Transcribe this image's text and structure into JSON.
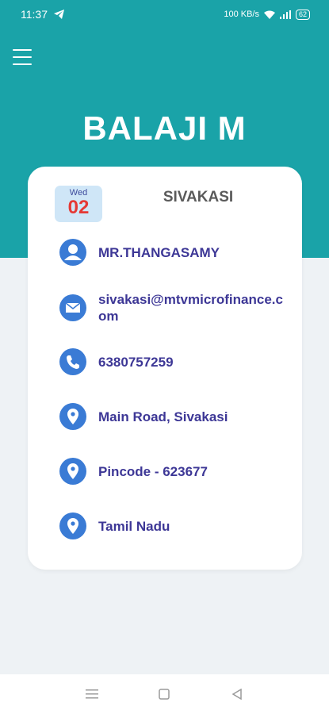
{
  "status_bar": {
    "time": "11:37",
    "network": "100 KB/s",
    "battery": "62"
  },
  "header": {
    "name": "BALAJI M"
  },
  "card": {
    "date": {
      "day": "Wed",
      "number": "02"
    },
    "branch": "SIVAKASI",
    "contact_person": "MR.THANGASAMY",
    "email": "sivakasi@mtvmicrofinance.com",
    "phone": "6380757259",
    "address": "Main Road, Sivakasi",
    "pincode": "Pincode - 623677",
    "state": "Tamil Nadu"
  },
  "colors": {
    "header": "#1aa3a8",
    "icon": "#3a7bd5",
    "text": "#3d3796",
    "date_number": "#e53935"
  }
}
